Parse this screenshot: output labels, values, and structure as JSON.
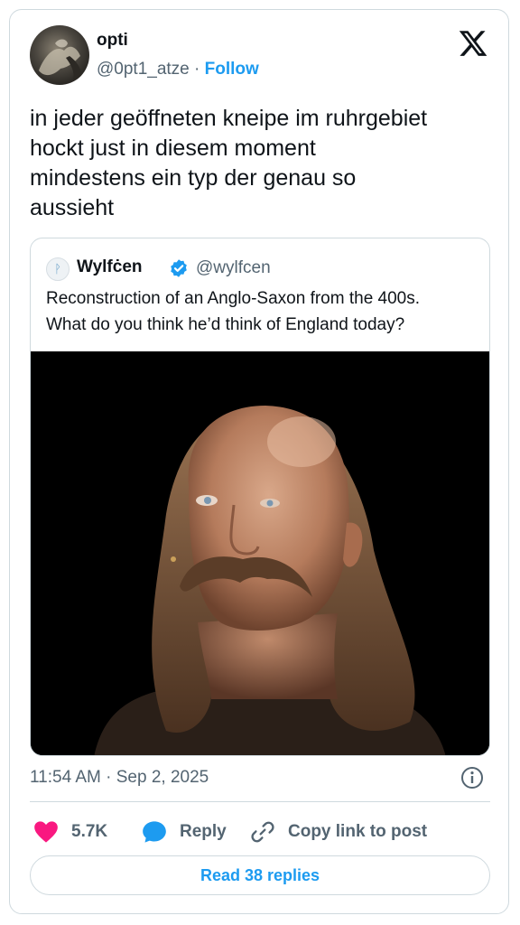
{
  "author": {
    "display_name": "opti",
    "handle": "@0pt1_atze",
    "separator": "·",
    "follow_label": "Follow"
  },
  "tweet": {
    "text": "in jeder geöffneten kneipe im ruhrgebiet\nhockt just in diesem moment\nmindestens ein typ der genau so\naussieht",
    "timestamp": "11:54 AM · Sep 2, 2025"
  },
  "quoted": {
    "name": "Wylfċen",
    "handle": "@wylfcen",
    "avatar_glyph": "ᚹ",
    "text": "Reconstruction of an Anglo-Saxon from the 400s.\nWhat do you think he’d think of England today?"
  },
  "actions": {
    "likes_count": "5.7K",
    "reply_label": "Reply",
    "copy_label": "Copy link to post",
    "read_replies_label": "Read 38 replies"
  },
  "colors": {
    "accent": "#1d9bf0",
    "like": "#f91880",
    "text": "#0f1419",
    "muted": "#536471",
    "border": "#cfd9de"
  },
  "icons": [
    "x-logo-icon",
    "info-icon",
    "heart-icon",
    "reply-bubble-icon",
    "link-icon",
    "verified-badge-icon"
  ]
}
